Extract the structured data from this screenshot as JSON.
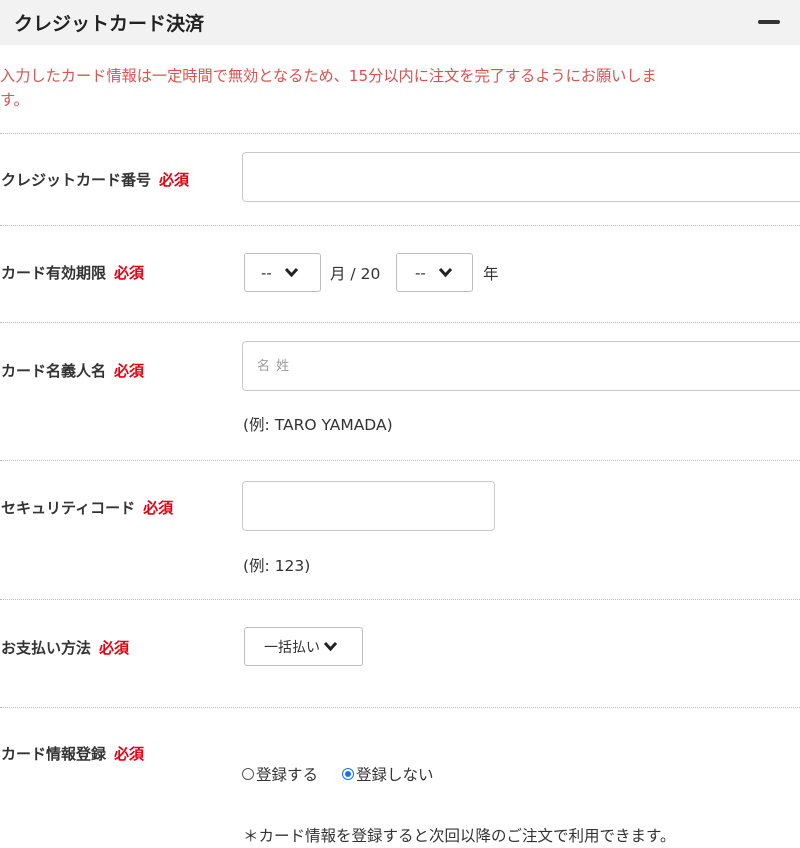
{
  "header": {
    "title": "クレジットカード決済",
    "collapse_icon": "minus-icon"
  },
  "notice": {
    "line1": "入力したカード情報は一定時間で無効となるため、15分以内に注文を完了するようにお願いしま",
    "line2": "す。",
    "color": "#d9534f"
  },
  "required_label": "必須",
  "card_number": {
    "label": "クレジットカード番号",
    "value": "",
    "placeholder": ""
  },
  "expiry": {
    "label": "カード有効期限",
    "month_value": "--",
    "month_unit": "月 / 20",
    "year_value": "--",
    "year_unit": "年"
  },
  "holder": {
    "label": "カード名義人名",
    "placeholder": "名 姓",
    "example": "(例: TARO YAMADA)"
  },
  "security": {
    "label": "セキュリティコード",
    "placeholder": "",
    "example": "(例: 123)"
  },
  "payment": {
    "label": "お支払い方法",
    "value": "一括払い"
  },
  "register": {
    "label": "カード情報登録",
    "options": [
      {
        "label": "登録する",
        "checked": false
      },
      {
        "label": "登録しない",
        "checked": true
      }
    ],
    "note": "＊カード情報を登録すると次回以降のご注文で利用できます。"
  },
  "colors": {
    "required": "#e60012",
    "header_bg": "#f2f2f2"
  }
}
